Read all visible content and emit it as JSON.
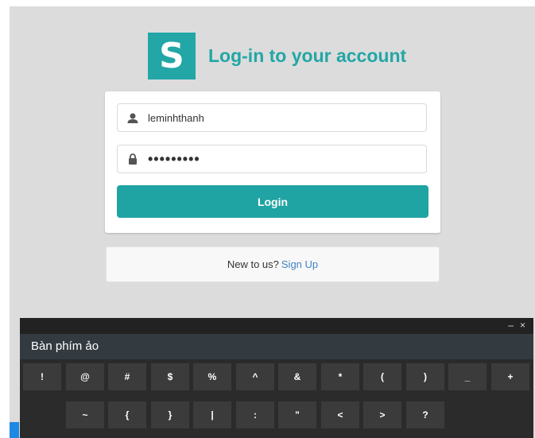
{
  "header": {
    "logo_letter": "S",
    "title": "Log-in to your account"
  },
  "form": {
    "username_value": "leminhthanh",
    "password_value": "•••••••••",
    "login_label": "Login"
  },
  "signup": {
    "text": "New to us?",
    "link": "Sign Up"
  },
  "keyboard": {
    "title": "Bàn phím ảo",
    "minimize": "–",
    "close": "×",
    "row1": [
      "!",
      "@",
      "#",
      "$",
      "%",
      "^",
      "&",
      "*",
      "(",
      ")",
      "_",
      "+"
    ],
    "row2": [
      "~",
      "{",
      "}",
      "|",
      ":",
      "\"",
      "<",
      ">",
      "?"
    ]
  },
  "colors": {
    "accent": "#22a6a6",
    "link": "#4183c4",
    "keyboard_bg": "#2b2b2b"
  }
}
